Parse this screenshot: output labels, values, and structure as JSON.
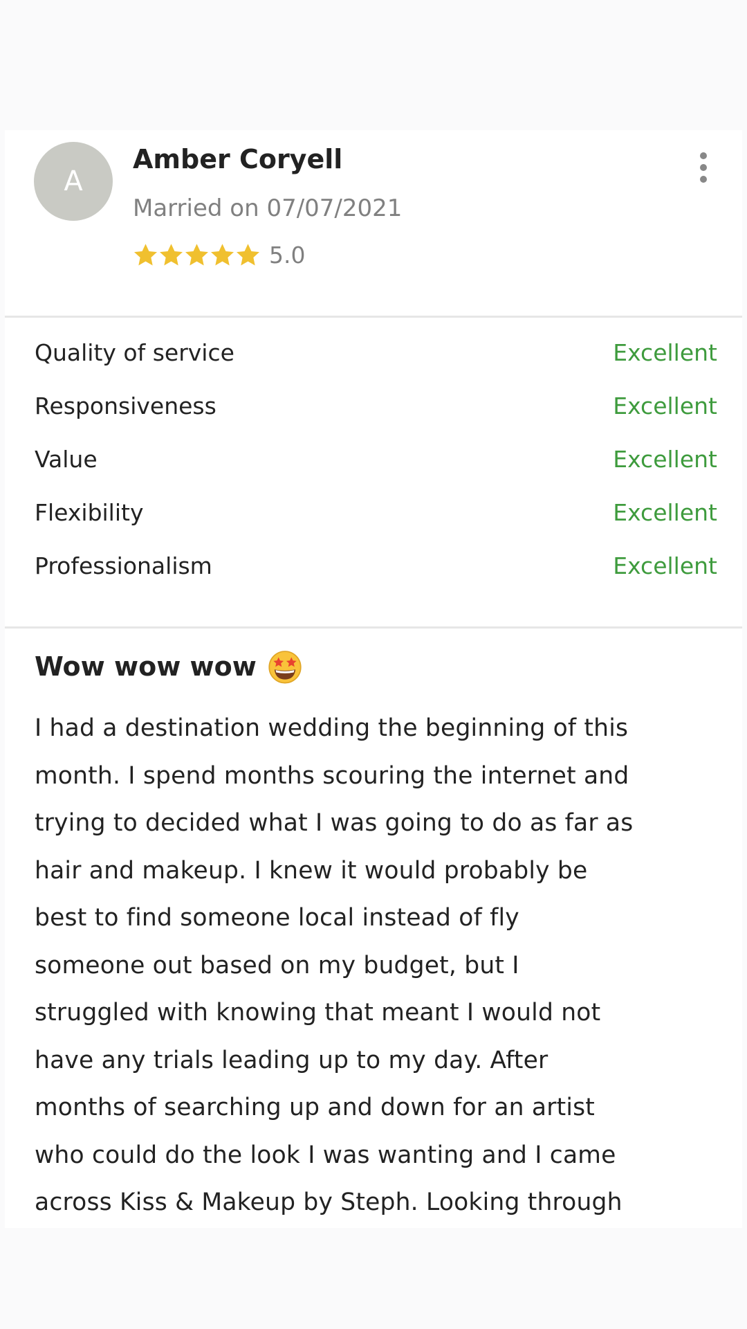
{
  "reviewer": {
    "avatar_letter": "A",
    "name": "Amber Coryell",
    "married_label": "Married on 07/07/2021",
    "stars": 5,
    "rating": "5.0"
  },
  "scores": [
    {
      "label": "Quality of service",
      "value": "Excellent"
    },
    {
      "label": "Responsiveness",
      "value": "Excellent"
    },
    {
      "label": "Value",
      "value": "Excellent"
    },
    {
      "label": "Flexibility",
      "value": "Excellent"
    },
    {
      "label": "Professionalism",
      "value": "Excellent"
    }
  ],
  "review": {
    "title": "Wow wow wow",
    "emoji": "star-struck-emoji",
    "body_lines": [
      "I had a destination wedding the beginning of this",
      "month. I spend months scouring the internet and",
      "trying to decided what I was going to do as far as",
      "hair and makeup. I knew it would probably be",
      "best to find someone local instead of fly",
      "someone out based on my budget, but I",
      "struggled with knowing that meant I would not",
      "have any trials leading up to my day. After",
      "months of searching up and down for an artist",
      "who could do the look I was wanting and I came",
      "across Kiss & Makeup by Steph. Looking through"
    ]
  },
  "colors": {
    "star": "#f0c02f",
    "excellent": "#3e9b3d",
    "avatar_bg": "#c9cac4"
  }
}
